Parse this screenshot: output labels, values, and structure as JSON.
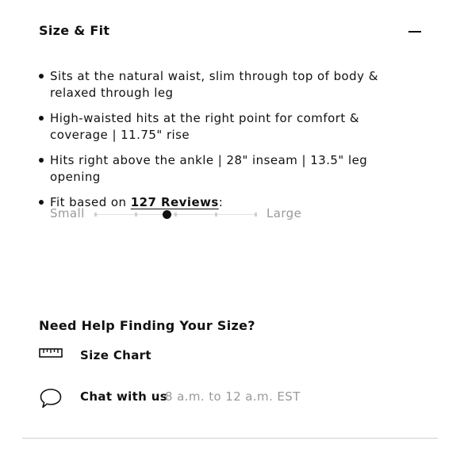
{
  "section": {
    "title": "Size & Fit",
    "collapse_icon": "minus-icon"
  },
  "features": [
    "Sits at the natural waist, slim through top of body & relaxed through leg",
    "High-waisted hits at the right point for comfort & coverage | 11.75\" rise",
    "Hits right above the ankle | 28\" inseam | 13.5\" leg opening"
  ],
  "fit": {
    "prefix": "Fit based on ",
    "reviews_link": "127 Reviews",
    "suffix": ":",
    "scale_min_label": "Small",
    "scale_max_label": "Large",
    "scale_steps": 5,
    "fit_position": 0.45
  },
  "help": {
    "title": "Need Help Finding Your Size?",
    "size_chart": {
      "icon": "ruler-icon",
      "label": "Size Chart"
    },
    "chat": {
      "icon": "chat-bubble-icon",
      "label": "Chat with us",
      "hours": "8 a.m. to 12 a.m. EST"
    }
  }
}
